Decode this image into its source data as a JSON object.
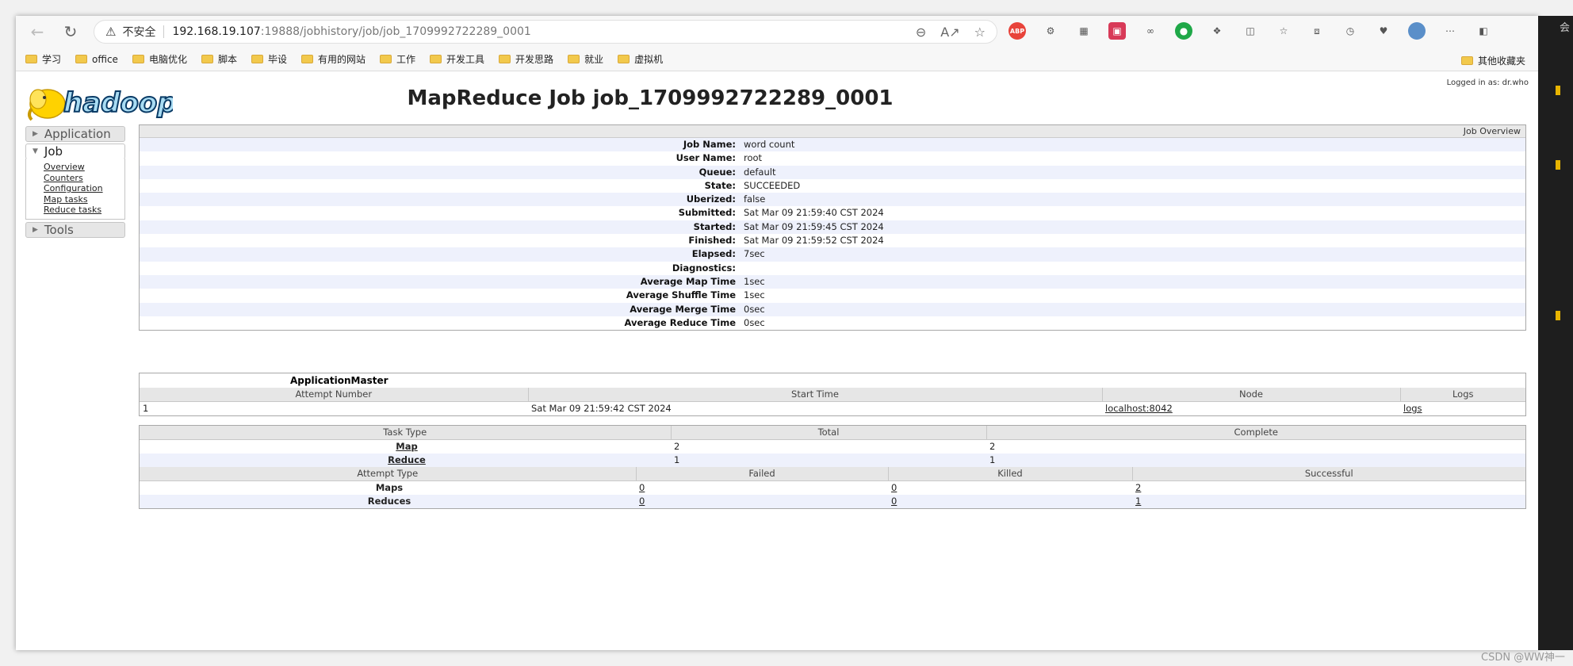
{
  "browser": {
    "security_label": "不安全",
    "url_host": "192.168.19.107",
    "url_path": ":19888/jobhistory/job/job_1709992722289_0001",
    "bookmarks": [
      "学习",
      "office",
      "电脑优化",
      "脚本",
      "毕设",
      "有用的网站",
      "工作",
      "开发工具",
      "开发思路",
      "就业",
      "虚拟机"
    ],
    "other_bookmarks": "其他收藏夹",
    "abp_label": "ABP"
  },
  "page": {
    "logo_text": "hadoop",
    "title": "MapReduce Job job_1709992722289_0001",
    "logged_in": "Logged in as: dr.who"
  },
  "nav": {
    "application": "Application",
    "job": "Job",
    "job_links": [
      "Overview",
      "Counters",
      "Configuration",
      "Map tasks",
      "Reduce tasks"
    ],
    "tools": "Tools"
  },
  "overview": {
    "header": "Job Overview",
    "rows": [
      {
        "k": "Job Name:",
        "v": "word count"
      },
      {
        "k": "User Name:",
        "v": "root"
      },
      {
        "k": "Queue:",
        "v": "default"
      },
      {
        "k": "State:",
        "v": "SUCCEEDED"
      },
      {
        "k": "Uberized:",
        "v": "false"
      },
      {
        "k": "Submitted:",
        "v": "Sat Mar 09 21:59:40 CST 2024"
      },
      {
        "k": "Started:",
        "v": "Sat Mar 09 21:59:45 CST 2024"
      },
      {
        "k": "Finished:",
        "v": "Sat Mar 09 21:59:52 CST 2024"
      },
      {
        "k": "Elapsed:",
        "v": "7sec"
      },
      {
        "k": "Diagnostics:",
        "v": ""
      },
      {
        "k": "Average Map Time",
        "v": "1sec"
      },
      {
        "k": "Average Shuffle Time",
        "v": "1sec"
      },
      {
        "k": "Average Merge Time",
        "v": "0sec"
      },
      {
        "k": "Average Reduce Time",
        "v": "0sec"
      }
    ]
  },
  "am": {
    "title": "ApplicationMaster",
    "headers": [
      "Attempt Number",
      "Start Time",
      "Node",
      "Logs"
    ],
    "row": {
      "attempt": "1",
      "start": "Sat Mar 09 21:59:42 CST 2024",
      "node": "localhost:8042",
      "logs": "logs"
    }
  },
  "tasks": {
    "headers": [
      "Task Type",
      "Total",
      "Complete"
    ],
    "rows": [
      {
        "type": "Map",
        "total": "2",
        "complete": "2"
      },
      {
        "type": "Reduce",
        "total": "1",
        "complete": "1"
      }
    ],
    "attempt_headers": [
      "Attempt Type",
      "Failed",
      "Killed",
      "Successful"
    ],
    "attempt_rows": [
      {
        "type": "Maps",
        "failed": "0",
        "killed": "0",
        "successful": "2"
      },
      {
        "type": "Reduces",
        "failed": "0",
        "killed": "0",
        "successful": "1"
      }
    ]
  },
  "overlay": {
    "right_label": "会",
    "watermark": "CSDN @WW神一"
  },
  "colors": {
    "stripe": "#eef1fc",
    "header_bg": "#e6e6e6",
    "logo_yellow": "#ffd200",
    "logo_blue": "#1d9bd7"
  }
}
